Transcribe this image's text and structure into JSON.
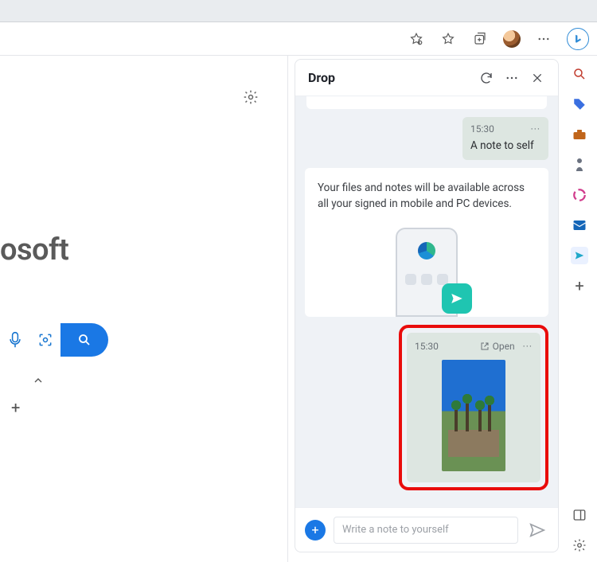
{
  "browser": {
    "bing_tooltip": "Bing"
  },
  "main": {
    "brand": "osoft"
  },
  "drop": {
    "title": "Drop",
    "note1": {
      "time": "15:30",
      "text": "A note to self"
    },
    "info": "Your files and notes will be available across all your signed in mobile and PC devices.",
    "image_msg": {
      "time": "15:30",
      "open": "Open"
    },
    "composer_placeholder": "Write a note to yourself"
  }
}
